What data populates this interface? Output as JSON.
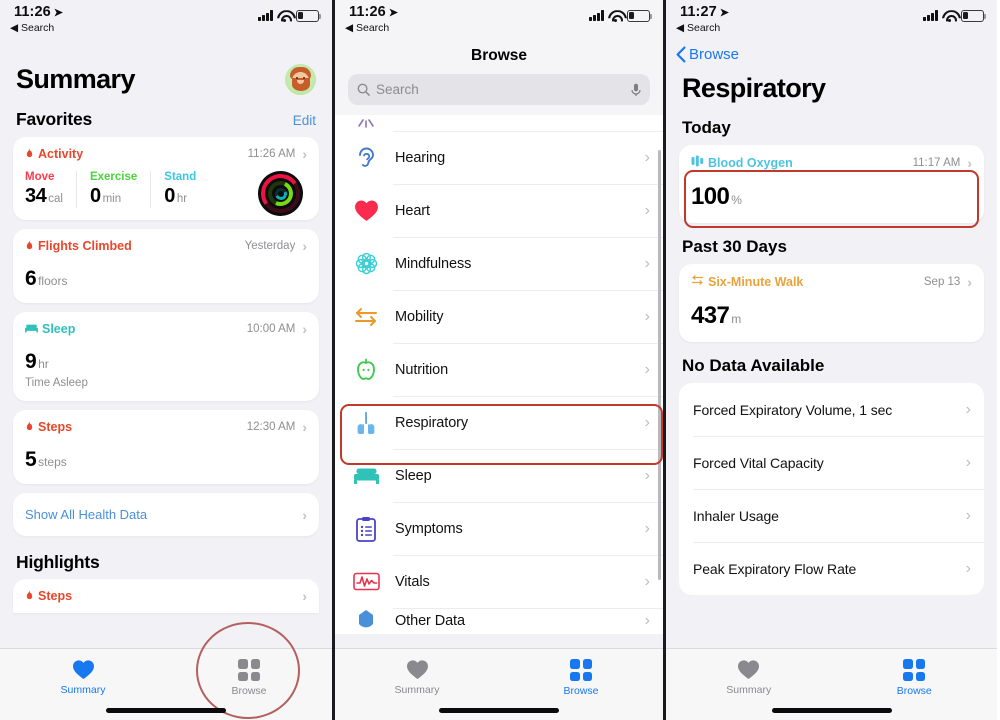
{
  "panels": {
    "summary": {
      "status": {
        "time": "11:26",
        "back_label": "Search",
        "location_icon": "location-arrow-icon"
      },
      "title": "Summary",
      "favorites_header": "Favorites",
      "edit_label": "Edit",
      "cards": [
        {
          "name": "Activity",
          "time": "11:26 AM",
          "icon": "flame-icon",
          "color": "#e8472b",
          "metrics": [
            {
              "label": "Move",
              "color": "#fa3c4c",
              "value": "34",
              "unit": "cal"
            },
            {
              "label": "Exercise",
              "color": "#4ad33a",
              "value": "0",
              "unit": "min"
            },
            {
              "label": "Stand",
              "color": "#3ac8e0",
              "value": "0",
              "unit": "hr"
            }
          ]
        },
        {
          "name": "Flights Climbed",
          "time": "Yesterday",
          "icon": "flame-icon",
          "color": "#e8472b",
          "value": "6",
          "unit": "floors"
        },
        {
          "name": "Sleep",
          "time": "10:00 AM",
          "icon": "bed-icon",
          "color": "#2fc2b8",
          "value": "9",
          "unit": "hr",
          "sublabel": "Time Asleep"
        },
        {
          "name": "Steps",
          "time": "12:30 AM",
          "icon": "flame-icon",
          "color": "#e8472b",
          "value": "5",
          "unit": "steps"
        }
      ],
      "show_all_label": "Show All Health Data",
      "highlights_header": "Highlights",
      "highlight_card": {
        "name": "Steps",
        "icon": "flame-icon",
        "color": "#e8472b"
      },
      "tabs": [
        {
          "label": "Summary",
          "icon": "heart-icon",
          "active": true
        },
        {
          "label": "Browse",
          "icon": "grid-icon",
          "active": false
        }
      ],
      "annotation": "circle-around-browse-tab"
    },
    "browse": {
      "status": {
        "time": "11:26",
        "back_label": "Search"
      },
      "nav_title": "Browse",
      "search": {
        "placeholder": "Search",
        "icon": "search-icon",
        "mic_icon": "microphone-icon"
      },
      "items": [
        {
          "label": "Hearing",
          "icon": "ear-icon",
          "color": "#3d7ccc"
        },
        {
          "label": "Heart",
          "icon": "heart-icon",
          "color": "#fa2b4e"
        },
        {
          "label": "Mindfulness",
          "icon": "mindfulness-icon",
          "color": "#3ecfd6"
        },
        {
          "label": "Mobility",
          "icon": "mobility-icon",
          "color": "#e89a2c"
        },
        {
          "label": "Nutrition",
          "icon": "apple-icon",
          "color": "#3cc94a"
        },
        {
          "label": "Respiratory",
          "icon": "lungs-icon",
          "color": "#4fa8e8",
          "selected": true
        },
        {
          "label": "Sleep",
          "icon": "bed-icon",
          "color": "#2fc2b8"
        },
        {
          "label": "Symptoms",
          "icon": "clipboard-icon",
          "color": "#4a44c4"
        },
        {
          "label": "Vitals",
          "icon": "waveform-icon",
          "color": "#e8334f"
        },
        {
          "label": "Other Data",
          "icon": "other-data-icon",
          "color": "#4a90d9"
        }
      ],
      "tabs": [
        {
          "label": "Summary",
          "icon": "heart-icon",
          "active": false
        },
        {
          "label": "Browse",
          "icon": "grid-icon",
          "active": true
        }
      ],
      "annotation": "box-around-respiratory-row"
    },
    "respiratory": {
      "status": {
        "time": "11:27",
        "back_label": "Search"
      },
      "back_nav": "Browse",
      "title": "Respiratory",
      "today_header": "Today",
      "today_card": {
        "name": "Blood Oxygen",
        "icon": "blood-oxygen-icon",
        "color": "#4ec3e0",
        "time": "11:17 AM",
        "value": "100",
        "unit": "%"
      },
      "past30_header": "Past 30 Days",
      "past30_card": {
        "name": "Six-Minute Walk",
        "icon": "six-minute-walk-icon",
        "color": "#e8a33c",
        "time": "Sep 13",
        "value": "437",
        "unit": "m"
      },
      "nodata_header": "No Data Available",
      "nodata_items": [
        "Forced Expiratory Volume, 1 sec",
        "Forced Vital Capacity",
        "Inhaler Usage",
        "Peak Expiratory Flow Rate"
      ],
      "tabs": [
        {
          "label": "Summary",
          "icon": "heart-icon",
          "active": false
        },
        {
          "label": "Browse",
          "icon": "grid-icon",
          "active": true
        }
      ],
      "annotation": "box-around-blood-oxygen-card"
    }
  }
}
